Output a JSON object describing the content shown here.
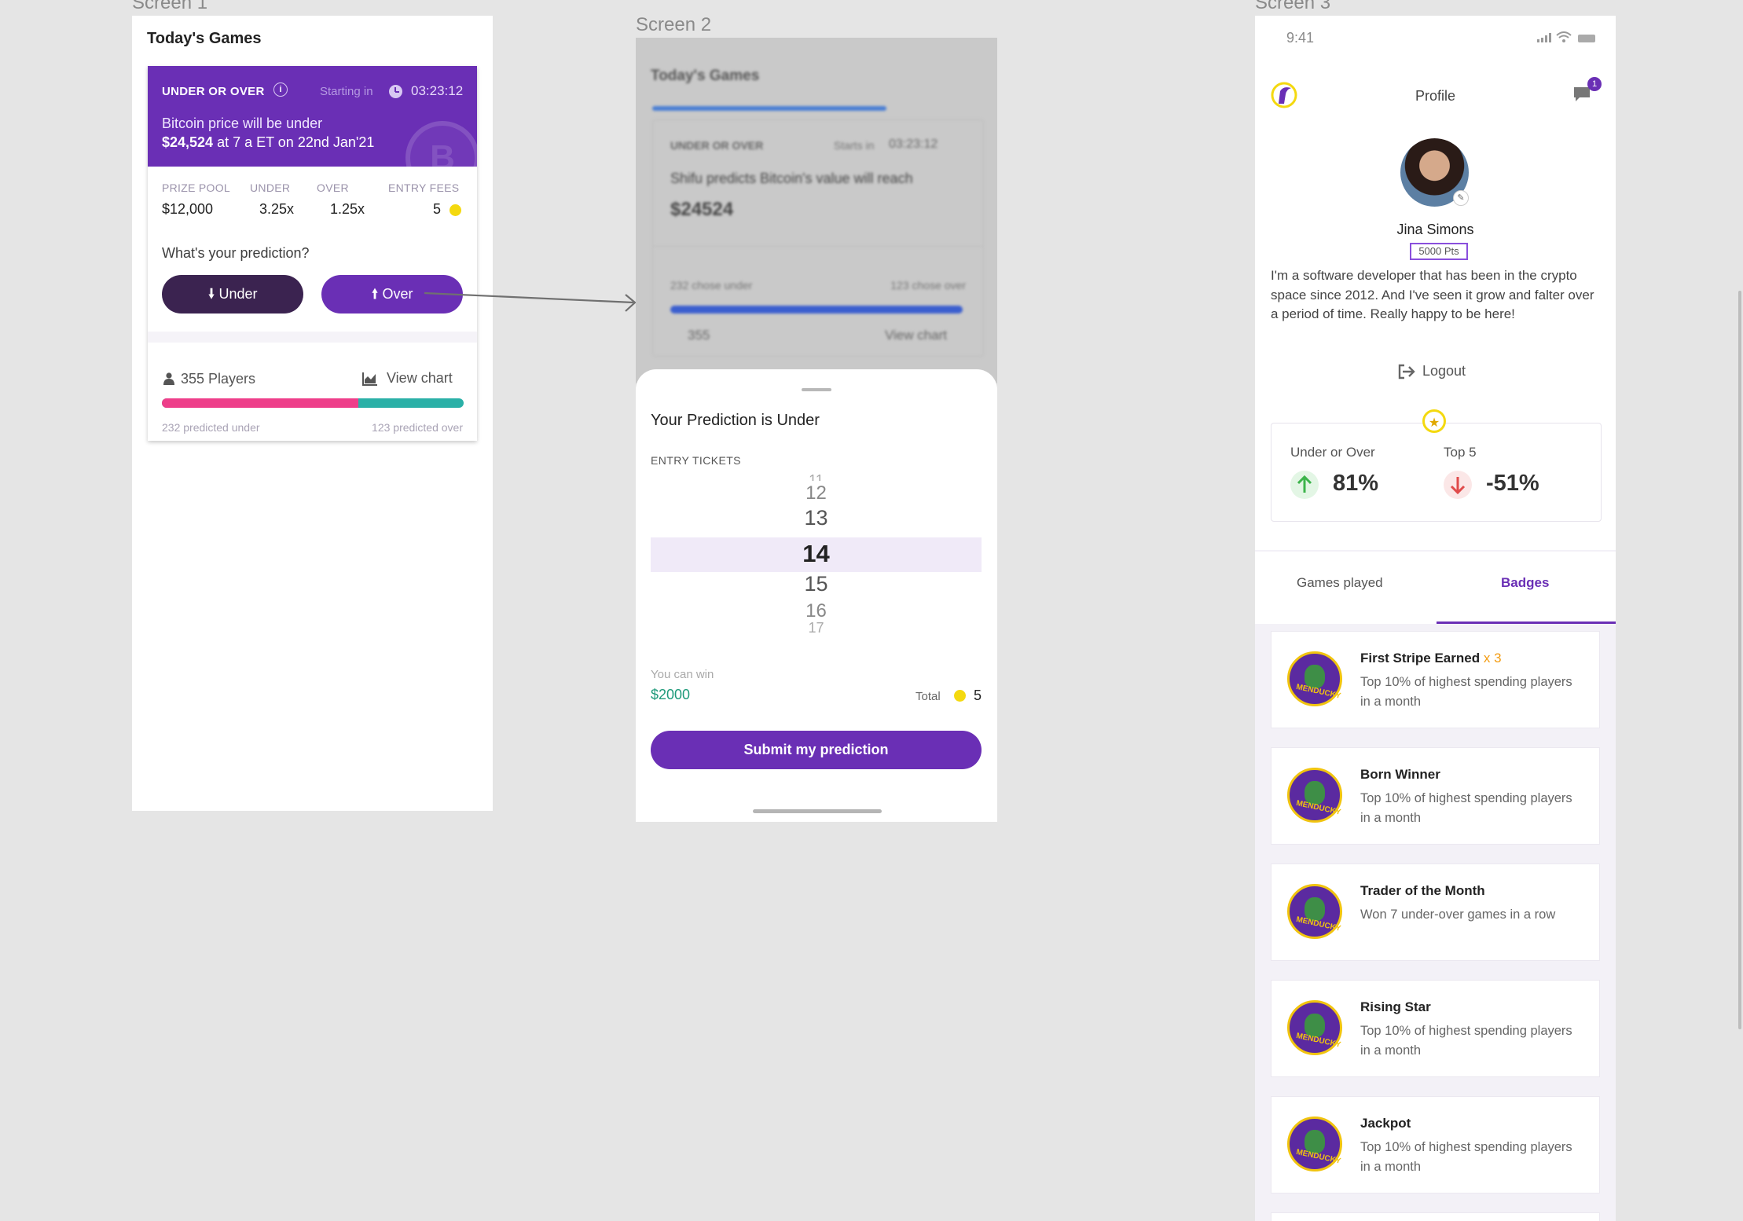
{
  "frame_labels": {
    "screen1": "Screen 1",
    "screen2": "Screen 2",
    "screen3": "Screen 3"
  },
  "screen1": {
    "title": "Today's Games",
    "card": {
      "tag": "UNDER OR OVER",
      "starting_label": "Starting in",
      "countdown": "03:23:12",
      "line1": "Bitcoin price will be under",
      "line2_bold": "$24,524",
      "line2_rest": " at 7 a ET on 22nd Jan'21",
      "coin_letter": "B",
      "stats": [
        {
          "label": "PRIZE POOL",
          "value": "$12,000"
        },
        {
          "label": "UNDER",
          "value": "3.25x"
        },
        {
          "label": "OVER",
          "value": "1.25x"
        },
        {
          "label": "ENTRY FEES",
          "value": "5"
        }
      ],
      "question": "What's your prediction?",
      "under_button": "Under",
      "over_button": "Over",
      "players": "355 Players",
      "view_chart": "View chart",
      "under_fraction": 0.65,
      "predicted_under": "232 predicted under",
      "predicted_over": "123 predicted over"
    },
    "colors": {
      "accent": "#6a2fb5",
      "under_bar": "#ee3e8a",
      "over_bar": "#2ab0a7"
    }
  },
  "screen2": {
    "bg": {
      "title": "Today's Games",
      "tag": "UNDER OR OVER",
      "starts_label": "Starts in",
      "countdown": "03:23:12",
      "statement": "Shifu predicts Bitcoin's value will reach",
      "price": "$24524",
      "chose_under": "232 chose under",
      "chose_over": "123 chose over",
      "players": "355",
      "view_chart": "View chart"
    },
    "sheet": {
      "title": "Your Prediction is Under",
      "entry_label": "ENTRY TICKETS",
      "picker": [
        "11",
        "12",
        "13",
        "14",
        "15",
        "16",
        "17"
      ],
      "selected": "14",
      "can_win_label": "You can win",
      "can_win_value": "$2000",
      "total_label": "Total",
      "total_value": "5",
      "submit": "Submit my prediction"
    }
  },
  "screen3": {
    "status_time": "9:41",
    "page_title": "Profile",
    "chat_badge": "1",
    "name": "Jina Simons",
    "points": "5000 Pts",
    "bio": "I'm a software developer that has been in the crypto space since 2012. And I've seen it grow and falter over a period of time. Really happy to be here!",
    "logout": "Logout",
    "stats": [
      {
        "label": "Under or Over",
        "value": "81%",
        "trend": "up"
      },
      {
        "label": "Top 5",
        "value": "-51%",
        "trend": "down"
      }
    ],
    "tabs": [
      "Games played",
      "Badges"
    ],
    "active_tab": "Badges",
    "medal_text": "MENDUCKY",
    "badges": [
      {
        "title": "First Stripe Earned",
        "multiplier": "x 3",
        "desc": "Top 10% of highest spending players in a month"
      },
      {
        "title": "Born Winner",
        "multiplier": "",
        "desc": "Top 10% of highest spending players in a month"
      },
      {
        "title": "Trader of the Month",
        "multiplier": "",
        "desc": "Won 7 under-over games in a row"
      },
      {
        "title": "Rising Star",
        "multiplier": "",
        "desc": "Top 10% of highest spending players in a month"
      },
      {
        "title": "Jackpot",
        "multiplier": "",
        "desc": "Top 10% of highest spending players in a month"
      }
    ]
  }
}
